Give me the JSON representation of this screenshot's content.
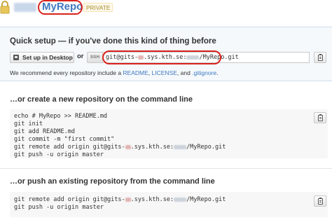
{
  "header": {
    "repo_name": "MyRepo",
    "private_badge": "PRIVATE"
  },
  "quick_setup": {
    "title": "Quick setup — if you've done this kind of thing before",
    "desktop_button": "Set up in Desktop",
    "or_text": "or",
    "protocol_button": "SSH",
    "clone_url_prefix": "git@gits-",
    "clone_url_mid": ".sys.kth.se:",
    "clone_url_suffix": "/MyRepo.git",
    "recommend": {
      "text_before": "We recommend every repository include a ",
      "readme": "README",
      "sep1": ", ",
      "license": "LICENSE",
      "sep2": ", and ",
      "gitignore": ".gitignore",
      "end": "."
    }
  },
  "new_repo": {
    "title": "…or create a new repository on the command line",
    "line1": "echo # MyRepo >> README.md",
    "line2": "git init",
    "line3": "git add README.md",
    "line4": "git commit -m \"first commit\"",
    "line5_prefix": "git remote add origin git@gits-",
    "line5_mid": ".sys.kth.se:",
    "line5_suffix": "/MyRepo.git",
    "line6": "git push -u origin master"
  },
  "existing_repo": {
    "title": "…or push an existing repository from the command line",
    "line1_prefix": "git remote add origin git@gits-",
    "line1_mid": ".sys.kth.se:",
    "line1_suffix": "/MyRepo.git",
    "line2": "git push -u origin master"
  },
  "colors": {
    "link": "#4078c0",
    "annotation_ring": "#d9221c",
    "private_badge_text": "#a1882b"
  },
  "icons": [
    "lock-icon",
    "desktop-icon",
    "clipboard-icon"
  ]
}
